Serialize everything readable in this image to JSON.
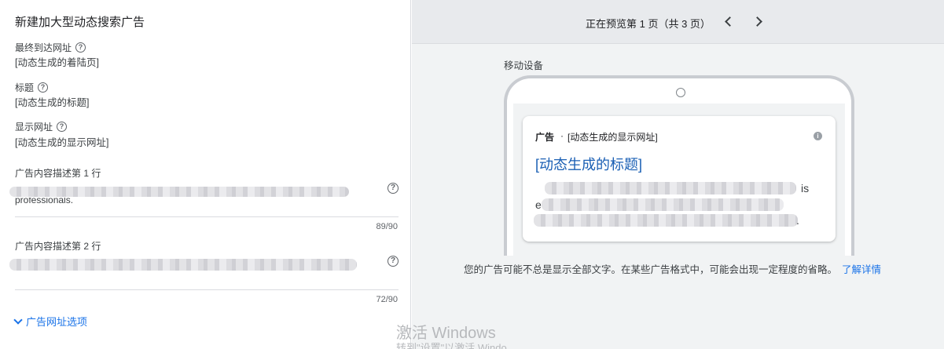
{
  "left_panel": {
    "title": "新建加大型动态搜索广告",
    "final_url": {
      "label": "最终到达网址",
      "value": "[动态生成的着陆页]"
    },
    "headline": {
      "label": "标题",
      "value": "[动态生成的标题]"
    },
    "display_url": {
      "label": "显示网址",
      "value": "[动态生成的显示网址]"
    },
    "description_1": {
      "label": "广告内容描述第 1 行",
      "visible_text": "professionals.",
      "counter": "89/90"
    },
    "description_2": {
      "label": "广告内容描述第 2 行",
      "counter": "72/90"
    },
    "url_options_label": "广告网址选项"
  },
  "preview": {
    "pager_text": "正在预览第 1 页（共 3 页）",
    "device_label": "移动设备",
    "ad": {
      "badge": "广告",
      "separator": "·",
      "display_url": "[动态生成的显示网址]",
      "headline": "[动态生成的标题]",
      "desc_fragment_1": "is",
      "desc_fragment_2": "e",
      "desc_fragment_3": "."
    },
    "disclaimer": "您的广告可能不总是显示全部文字。在某些广告格式中，可能会出现一定程度的省略。",
    "learn_more": "了解详情"
  },
  "watermark": {
    "line1": "激活 Windows",
    "line2": "转到\"设置\"以激活 Windo"
  },
  "icons": {
    "help": "?",
    "info": "i"
  }
}
